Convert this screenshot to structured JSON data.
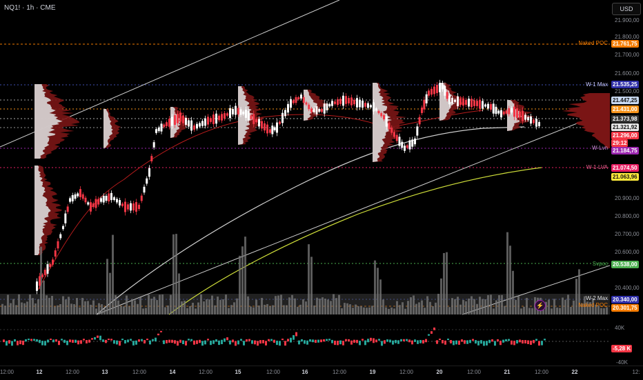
{
  "header": {
    "symbol": "NQ1!",
    "sep1": "·",
    "interval": "1h",
    "sep2": "·",
    "exchange": "CME"
  },
  "currency_button": "USD",
  "price_axis": [
    "21.900,00",
    "21.800,00",
    "21.700,00",
    "21.600,00",
    "21.500,00",
    "20.900,00",
    "20.800,00",
    "20.700,00",
    "20.600,00",
    "20.400,00"
  ],
  "price_tags": [
    {
      "value": "21.761,75",
      "bg": "#f57c00"
    },
    {
      "value": "21.535,25",
      "bg": "#2f2fa8"
    },
    {
      "value": "21.447,25",
      "bg": "#c8d8f0",
      "fg": "#111"
    },
    {
      "value": "21.431,00",
      "bg": "#f7931a"
    },
    {
      "value": "21.373,98",
      "bg": "#333333"
    },
    {
      "value": "21.321,92",
      "bg": "#e8e8e8",
      "fg": "#111"
    },
    {
      "value": "21.296,00",
      "bg": "#f23645"
    },
    {
      "value": "29:12",
      "bg": "#f23645"
    },
    {
      "value": "21.184,75",
      "bg": "#9c27b0"
    },
    {
      "value": "21.074,50",
      "bg": "#e91e63"
    },
    {
      "value": "21.063,96",
      "bg": "#ffeb3b",
      "fg": "#111"
    },
    {
      "value": "20.538,00",
      "bg": "#4caf50"
    },
    {
      "value": "20.340,00",
      "bg": "#2f2fa8"
    },
    {
      "value": "20.301,75",
      "bg": "#f57c00"
    }
  ],
  "level_labels": {
    "naked_poc_top": "Naked POC",
    "w1_max": "W-1 Max",
    "w_lvn": "W-Lvn",
    "w1_lva": "W-1-LVA",
    "svpoc": "Svpoc",
    "w2_max": "W-2 Max",
    "naked_poc_bottom": "Naked POC"
  },
  "oscillator": {
    "tick_top": "40K",
    "value": "-5,28 K",
    "tick_bottom": "-40K"
  },
  "time_axis": [
    "12:00",
    "12",
    "12:00",
    "13",
    "12:00",
    "14",
    "12:00",
    "15",
    "12:00",
    "16",
    "12:00",
    "19",
    "12:00",
    "20",
    "12:00",
    "21",
    "12:00",
    "22",
    "12:"
  ],
  "colors": {
    "up": "#ffffff",
    "down": "#f23645",
    "volume": "#787878",
    "ma_white": "#d0d0d0",
    "ma_yellow": "#cddc39",
    "ma_red": "#b71c1c",
    "osc_up": "#26a69a",
    "osc_down": "#f23645"
  }
}
